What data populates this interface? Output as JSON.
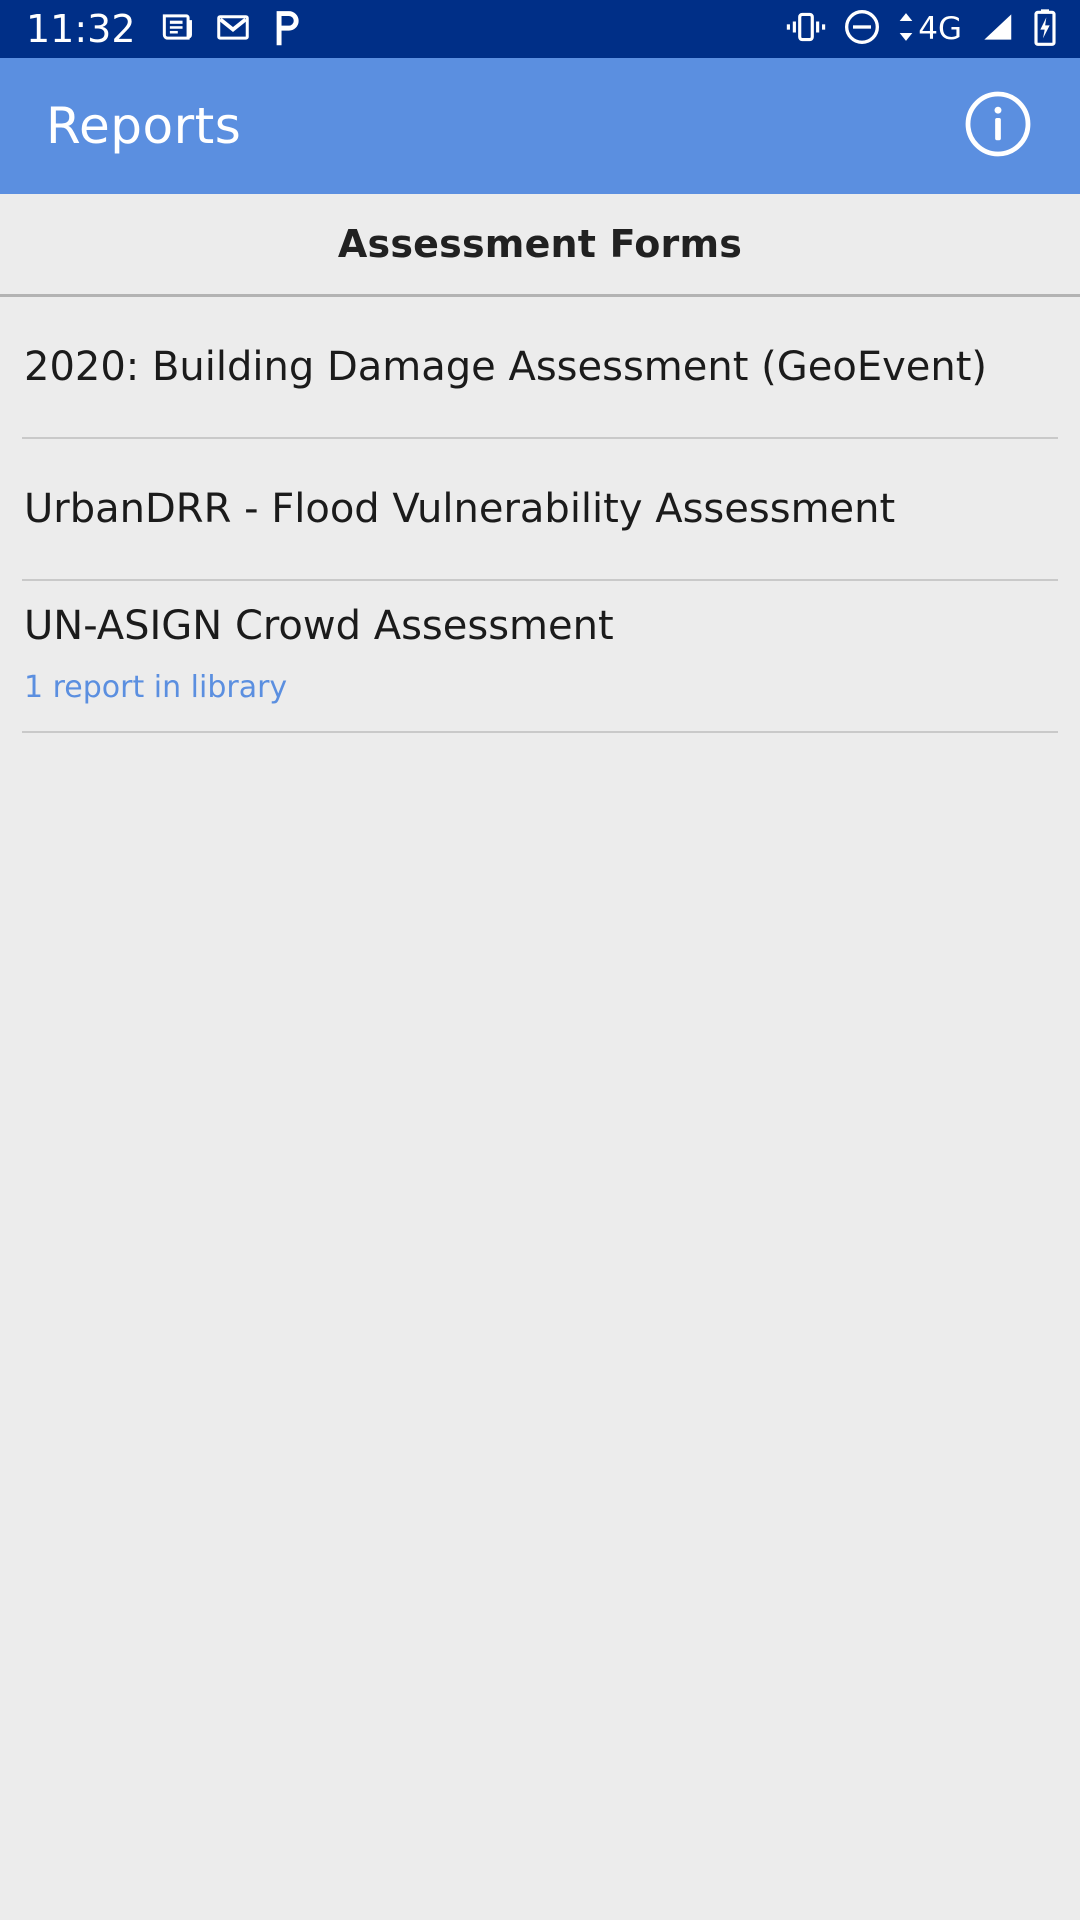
{
  "status_bar": {
    "time": "11:32",
    "background_color": "#002f87",
    "foreground_color": "#ffffff",
    "left_icons": [
      {
        "name": "news-article-icon"
      },
      {
        "name": "gmail-icon"
      },
      {
        "name": "pocket-p-icon"
      }
    ],
    "right_icons": [
      {
        "name": "vibrate-icon"
      },
      {
        "name": "do-not-disturb-icon"
      }
    ],
    "network": {
      "type_label": "4G",
      "data_arrows_icon": "data-transfer-arrows-icon",
      "signal_icon": "signal-bars-icon"
    },
    "battery": {
      "icon": "battery-charging-icon"
    }
  },
  "app_bar": {
    "title": "Reports",
    "background_color": "#5b8fe0",
    "title_color": "#ffffff",
    "action_icon": "info-circle-icon"
  },
  "content": {
    "background_color": "#ececec",
    "section_header": "Assessment Forms",
    "section_header_color": "#212121",
    "link_color": "#5b8fe0",
    "forms": [
      {
        "title": "2020: Building Damage Assessment (GeoEvent)",
        "subtitle": null
      },
      {
        "title": "UrbanDRR - Flood Vulnerability Assessment",
        "subtitle": null
      },
      {
        "title": "UN-ASIGN Crowd Assessment",
        "subtitle": "1 report in library"
      }
    ]
  }
}
